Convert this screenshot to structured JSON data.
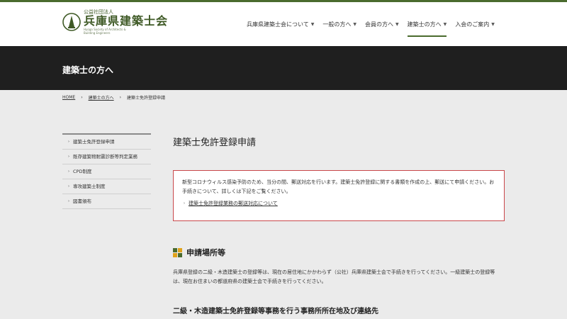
{
  "header": {
    "logo_small": "公益社団法人",
    "logo_main": "兵庫県建築士会",
    "logo_en_1": "Hyogo Society of Architects &",
    "logo_en_2": "Building Engineers",
    "nav": [
      {
        "label": "兵庫県建築士会について",
        "icon": "chevron-down-icon",
        "active": false
      },
      {
        "label": "一般の方へ",
        "icon": "chevron-down-icon",
        "active": false
      },
      {
        "label": "会員の方へ",
        "icon": "chevron-down-icon",
        "active": false
      },
      {
        "label": "建築士の方へ",
        "icon": "chevron-down-icon",
        "active": true
      },
      {
        "label": "入会のご案内",
        "icon": "chevron-down-icon",
        "active": false
      }
    ]
  },
  "banner": {
    "title": "建築士の方へ"
  },
  "breadcrumb": {
    "items": [
      "HOME",
      "建築士の方へ",
      "建築士免許登録申請"
    ],
    "separator": "›"
  },
  "sidebar": {
    "items": [
      {
        "label": "建築士免許登録申請"
      },
      {
        "label": "既存建築物耐震診断等判定業務"
      },
      {
        "label": "CPD制度"
      },
      {
        "label": "専攻建築士制度"
      },
      {
        "label": "図書頒布"
      }
    ]
  },
  "main": {
    "title": "建築士免許登録申請",
    "notice": {
      "text": "新型コロナウィルス感染予防のため、当分の間、郵送対応を行います。建築士免許登録に関する書類を作成の上、郵送にて申請ください。お手続きについて、詳しくは下記をご覧ください。",
      "link": "建築士免許登録業務の郵送対応について"
    },
    "section_title": "申請場所等",
    "paragraph": "兵庫県登録の二級・木造建築士の登録等は、現在の居住地にかかわらず（公社）兵庫県建築士会で手続きを行ってください。一級建築士の登録等は、現在お住まいの都道府県の建築士会で手続きを行ってください。",
    "subheading": "二級・木造建築士免許登録等事務を行う事務所所在地及び連絡先"
  },
  "colors": {
    "brand_green": "#4a6b2e",
    "banner_bg": "#1f1f1f",
    "notice_border": "#c9474a",
    "section_icon": [
      "#4a6b2e",
      "#e0a21b",
      "#e0a21b",
      "#4a6b2e"
    ]
  }
}
